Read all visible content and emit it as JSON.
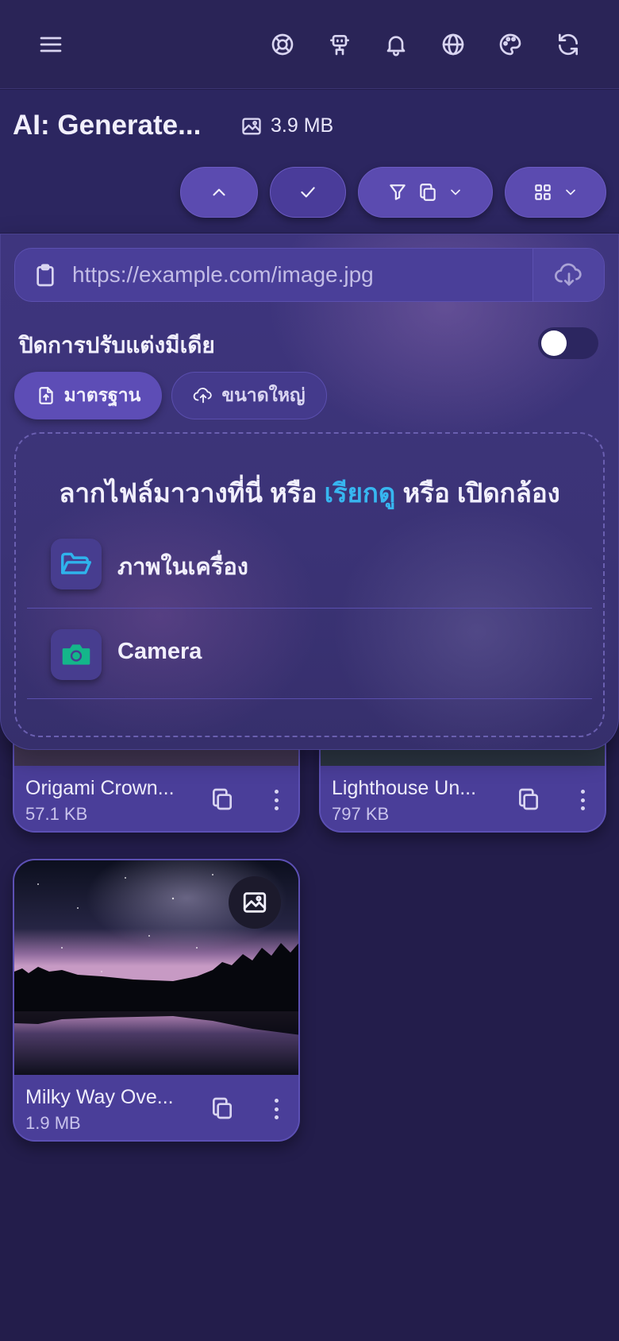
{
  "header": {
    "icons": [
      "menu-icon",
      "support-icon",
      "robot-icon",
      "bell-icon",
      "globe-icon",
      "palette-icon",
      "refresh-icon"
    ]
  },
  "album": {
    "title": "AI: Generate...",
    "size": "3.9 MB"
  },
  "upload_panel": {
    "url_placeholder": "https://example.com/image.jpg",
    "toggle_label": "ปิดการปรับแต่งมีเดีย",
    "toggle_on": false,
    "mode_standard": "มาตรฐาน",
    "mode_large": "ขนาดใหญ่",
    "drop_text_prefix": "ลากไฟล์มาวางที่นี่ หรือ",
    "drop_text_link": "เรียกดู",
    "drop_text_suffix": "หรือ เปิดกล้อง",
    "source_device": "ภาพในเครื่อง",
    "source_camera": "Camera",
    "accent_link": "#37b6f0"
  },
  "media": [
    {
      "name": "Origami Crown...",
      "size": "57.1 KB"
    },
    {
      "name": "Lighthouse Un...",
      "size": "797 KB"
    },
    {
      "name": "Milky Way Ove...",
      "size": "1.9 MB"
    }
  ],
  "colors": {
    "background": "#231d4b",
    "primary": "#5b4bb0",
    "card": "#4a3e99"
  }
}
